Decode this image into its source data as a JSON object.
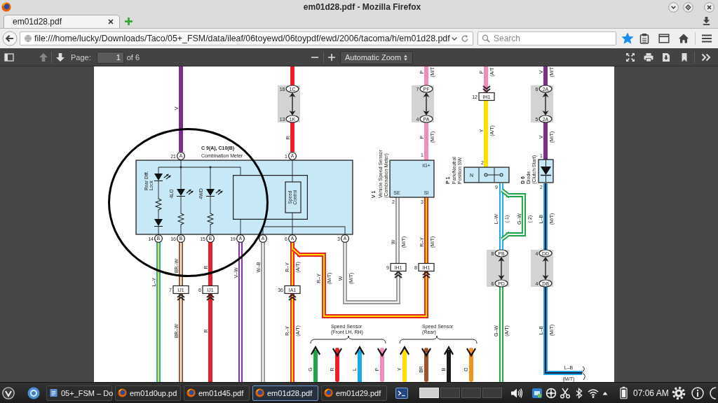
{
  "window": {
    "title": "em01d28.pdf - Mozilla Firefox"
  },
  "tabs": [
    {
      "label": "em01d28.pdf",
      "selected": true
    }
  ],
  "navbar": {
    "url": "file:///home/lucky/Downloads/Taco/05+_FSM/data/ileaf/06toyewd/06toypdf/ewd/2006/tacoma/h/em01d28.pdf",
    "search_placeholder": "Search",
    "bookmarked": true
  },
  "pdf_toolbar": {
    "previous_disabled": true,
    "page_label": "Page:",
    "page": "1",
    "page_count": "of 6",
    "zoom": "Automatic Zoom"
  },
  "diagram": {
    "components": [
      {
        "kind": "meter",
        "code": "C 9(A), C10(B)",
        "name": "Combination Meter",
        "indicators": [
          [
            "Rear Diff.",
            "Lock"
          ],
          [
            "4LO"
          ],
          [
            "4WD"
          ]
        ],
        "module": [
          "Speed",
          "Control"
        ],
        "pins": [
          {
            "number": "21",
            "letter": "A"
          },
          {
            "number": "1",
            "letter": "A"
          },
          {
            "number": "14",
            "letter": "B"
          },
          {
            "number": "16",
            "letter": "B"
          },
          {
            "number": "15",
            "letter": "B"
          },
          {
            "number": "19",
            "letter": "A"
          },
          {
            "letter": "A"
          },
          {
            "number": "6",
            "letter": "A"
          },
          {
            "number": "3",
            "letter": "A"
          }
        ]
      },
      {
        "kind": "sensor",
        "code": "V 1",
        "name": [
          "Vehicle Speed Sensor",
          "(Combination Meter)"
        ],
        "terminals": [
          "IG+",
          "SE",
          "SI"
        ],
        "pins": [
          "1",
          "2",
          "3"
        ]
      },
      {
        "kind": "switch",
        "code": "P 1",
        "name": [
          "Park/Neutral",
          "Position SW"
        ],
        "terminal": "N",
        "pins": [
          "2",
          "9"
        ]
      },
      {
        "kind": "diode",
        "code": "D 6",
        "name": [
          "Diode",
          "(Clutch Start)"
        ],
        "pins": [
          "1",
          "2"
        ]
      }
    ],
    "junctions": [
      {
        "top": {
          "pin": "16",
          "code": "1C"
        },
        "bottom": {
          "pin": "13",
          "code": "1K"
        }
      },
      {
        "top": {
          "pin": "7",
          "code": "PF"
        },
        "bottom": {
          "pin": "4",
          "code": "PA"
        }
      },
      {
        "top": {
          "pin": "6",
          "code": "2A"
        },
        "bottom": {
          "pin": "5",
          "code": "2A"
        }
      },
      {
        "top": {
          "pin": "8",
          "code": "PB"
        },
        "bottom": {
          "pin": "6",
          "code": "PD"
        }
      },
      {
        "top": {
          "pin": "4",
          "code": "DD"
        },
        "bottom": {
          "pin": "4",
          "code": "DB"
        }
      }
    ],
    "connectors": [
      {
        "pin": "12",
        "code": "IH1",
        "kind": "down"
      },
      {
        "pin": "7",
        "code": "IJ1",
        "kind": "up"
      },
      {
        "pin": "6",
        "code": "IJ1",
        "kind": "up"
      },
      {
        "pin": "36",
        "code": "IA1",
        "kind": "up"
      },
      {
        "pin": "9",
        "code": "IH1",
        "kind": "up"
      },
      {
        "pin": "8",
        "code": "IH1",
        "kind": "up"
      }
    ],
    "wires": [
      {
        "color": "#7a2f8f",
        "labels": [
          {
            "code": "V"
          }
        ]
      },
      {
        "color": "#e8202a",
        "labels": [
          {
            "code": "R"
          }
        ]
      },
      {
        "color": "#f08cbc",
        "labels": [
          {
            "code": "P",
            "note": "(M/T"
          },
          {
            "code": "P",
            "note": "(M/T)"
          }
        ]
      },
      {
        "color": "#f08cbc",
        "labels": [
          {
            "code": "P",
            "note": "(A/T"
          }
        ]
      },
      {
        "color": "#ffe000",
        "labels": [
          {
            "code": "Y",
            "note": "(A/T)"
          }
        ]
      },
      {
        "color": "#7a2f8f",
        "labels": [
          {
            "code": "V",
            "note": "(M/T"
          },
          {
            "code": "V",
            "note": "(M/T)"
          }
        ]
      },
      {
        "color": "#1ba8e6",
        "stripe": {
          "color": "#ffe000"
        },
        "labels": [
          {
            "code": "L–Y"
          }
        ]
      },
      {
        "color": "#a0522d",
        "stripe": {
          "color": "#f2f2f2"
        },
        "labels": [
          {
            "code": "BR–W"
          },
          {
            "code": "BR–W"
          }
        ]
      },
      {
        "color": "#e8202a",
        "labels": [
          {
            "code": "R"
          },
          {
            "code": "R"
          }
        ]
      },
      {
        "color": "#7a2f8f",
        "stripe": {
          "color": "#f2f2f2"
        },
        "labels": [
          {
            "code": "V–W"
          }
        ]
      },
      {
        "color": "#9a9a9a",
        "stripe": {
          "color": "#f2f2f2"
        },
        "labels": [
          {
            "code": "W–B"
          }
        ]
      },
      {
        "color": "#e8202a",
        "stripe": {
          "color": "#ffe000"
        },
        "labels": [
          {
            "code": "R–Y",
            "note": "(A/T)"
          },
          {
            "code": "R–Y",
            "note": "(A/T)"
          }
        ]
      },
      {
        "color": "#e8202a",
        "stripe": {
          "color": "#ffe000"
        },
        "labels": [
          {
            "code": "R–Y",
            "note": "(M/T)"
          }
        ]
      },
      {
        "color": "#9a9a9a",
        "stripe": {
          "color": "#f2f2f2"
        },
        "labels": [
          {
            "code": "W",
            "note": "(M/T)"
          }
        ]
      },
      {
        "color": "#9a9a9a",
        "stripe": {
          "color": "#f2f2f2"
        },
        "labels": [
          {
            "code": "W",
            "note": "(M/T)"
          }
        ]
      },
      {
        "color": "#e8202a",
        "stripe": {
          "color": "#ffe000"
        },
        "labels": [
          {
            "code": "R–Y",
            "note": "(M/T)"
          }
        ]
      },
      {
        "color": "#1ba8e6",
        "stripe": {
          "color": "#f2f2f2"
        },
        "labels": [
          {
            "code": "L–W",
            "note": "( 1)"
          }
        ]
      },
      {
        "color": "#1aa84a",
        "stripe": {
          "color": "#f2f2f2"
        },
        "labels": [
          {
            "code": "G–W",
            "note": "( 2)"
          }
        ]
      },
      {
        "color": "#1aa84a",
        "stripe": {
          "color": "#f2f2f2"
        },
        "labels": [
          {
            "code": "G–W",
            "note": "(A/T)"
          }
        ]
      },
      {
        "color": "#1ba8e6",
        "stripe": {
          "color": "#1a1a40"
        },
        "labels": [
          {
            "code": "L–B",
            "note": "(M/T)"
          },
          {
            "code": "L–B",
            "note": "(M/T)"
          },
          {
            "code": "L–B",
            "note": "(M/T)"
          }
        ]
      }
    ],
    "sensor_groups": [
      {
        "title": [
          "Speed Sensor",
          "(Front LH,  RH)"
        ],
        "leads": [
          {
            "label": "G",
            "color": "#1aa84a",
            "kind": "in"
          },
          {
            "label": "R",
            "color": "#e8202a",
            "kind": "out"
          },
          {
            "label": "L",
            "color": "#1ba8e6",
            "kind": "in"
          },
          {
            "label": "P",
            "color": "#f08cbc",
            "kind": "out"
          }
        ]
      },
      {
        "title": [
          "Speed Sensor",
          "(Rear)"
        ],
        "leads": [
          {
            "label": "Y",
            "color": "#ffe000",
            "kind": "in"
          },
          {
            "label": "BR",
            "color": "#a0522d",
            "kind": "out"
          },
          {
            "label": "B",
            "color": "#1a1a1a",
            "kind": "in"
          },
          {
            "label": "O",
            "color": "#f7941d",
            "kind": "out"
          }
        ]
      }
    ]
  },
  "taskbar": {
    "windows": [
      {
        "label": "05+_FSM – Do",
        "kind": "files",
        "selected": false
      },
      {
        "label": "em01d0up.pd",
        "kind": "browser",
        "selected": false
      },
      {
        "label": "em01d45.pdf",
        "kind": "browser",
        "selected": false
      },
      {
        "label": "em01d28.pdf",
        "kind": "browser",
        "selected": true
      },
      {
        "label": "em01d29.pdf",
        "kind": "browser",
        "selected": false
      }
    ],
    "desktops": [
      {
        "selected": true
      },
      {
        "selected": false
      },
      {
        "selected": false
      },
      {
        "selected": false
      }
    ],
    "clock": "07:06 AM"
  }
}
